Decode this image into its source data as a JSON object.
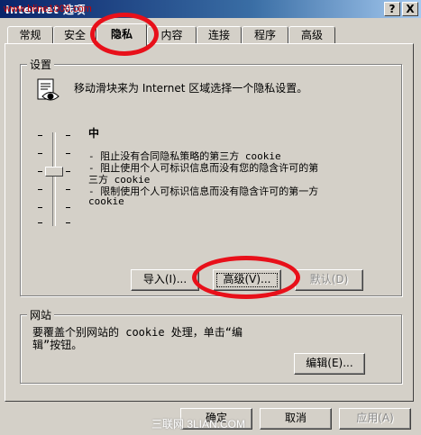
{
  "window": {
    "title": "Internet 选项",
    "watermark": "www.bline1000.com",
    "help_button": "?",
    "close_button": "X"
  },
  "tabs": [
    {
      "label": "常规"
    },
    {
      "label": "安全"
    },
    {
      "label": "隐私",
      "active": true
    },
    {
      "label": "内容"
    },
    {
      "label": "连接"
    },
    {
      "label": "程序"
    },
    {
      "label": "高级"
    }
  ],
  "settings": {
    "group_label": "设置",
    "intro": "移动滑块来为 Internet 区域选择一个隐私设置。",
    "level": "中",
    "lines": [
      "- 阻止没有合同隐私策略的第三方 cookie",
      "- 阻止使用个人可标识信息而没有您的隐含许可的第",
      "三方 cookie",
      "- 限制使用个人可标识信息而没有隐含许可的第一方",
      "cookie"
    ],
    "slider_level_fraction": 0.6,
    "buttons": {
      "import": "导入(I)...",
      "advanced": "高级(V)...",
      "default": "默认(D)"
    }
  },
  "websites": {
    "group_label": "网站",
    "text_line1": "要覆盖个别网站的 cookie 处理，单击“编",
    "text_line2": "辑”按钮。",
    "edit_button": "编辑(E)..."
  },
  "footer": {
    "ok": "确定",
    "cancel": "取消",
    "apply": "应用(A)",
    "watermark": "三联网 3LIAN.COM"
  },
  "colors": {
    "highlight_ring": "#e8101a",
    "dialog_face": "#d4d0c8"
  }
}
